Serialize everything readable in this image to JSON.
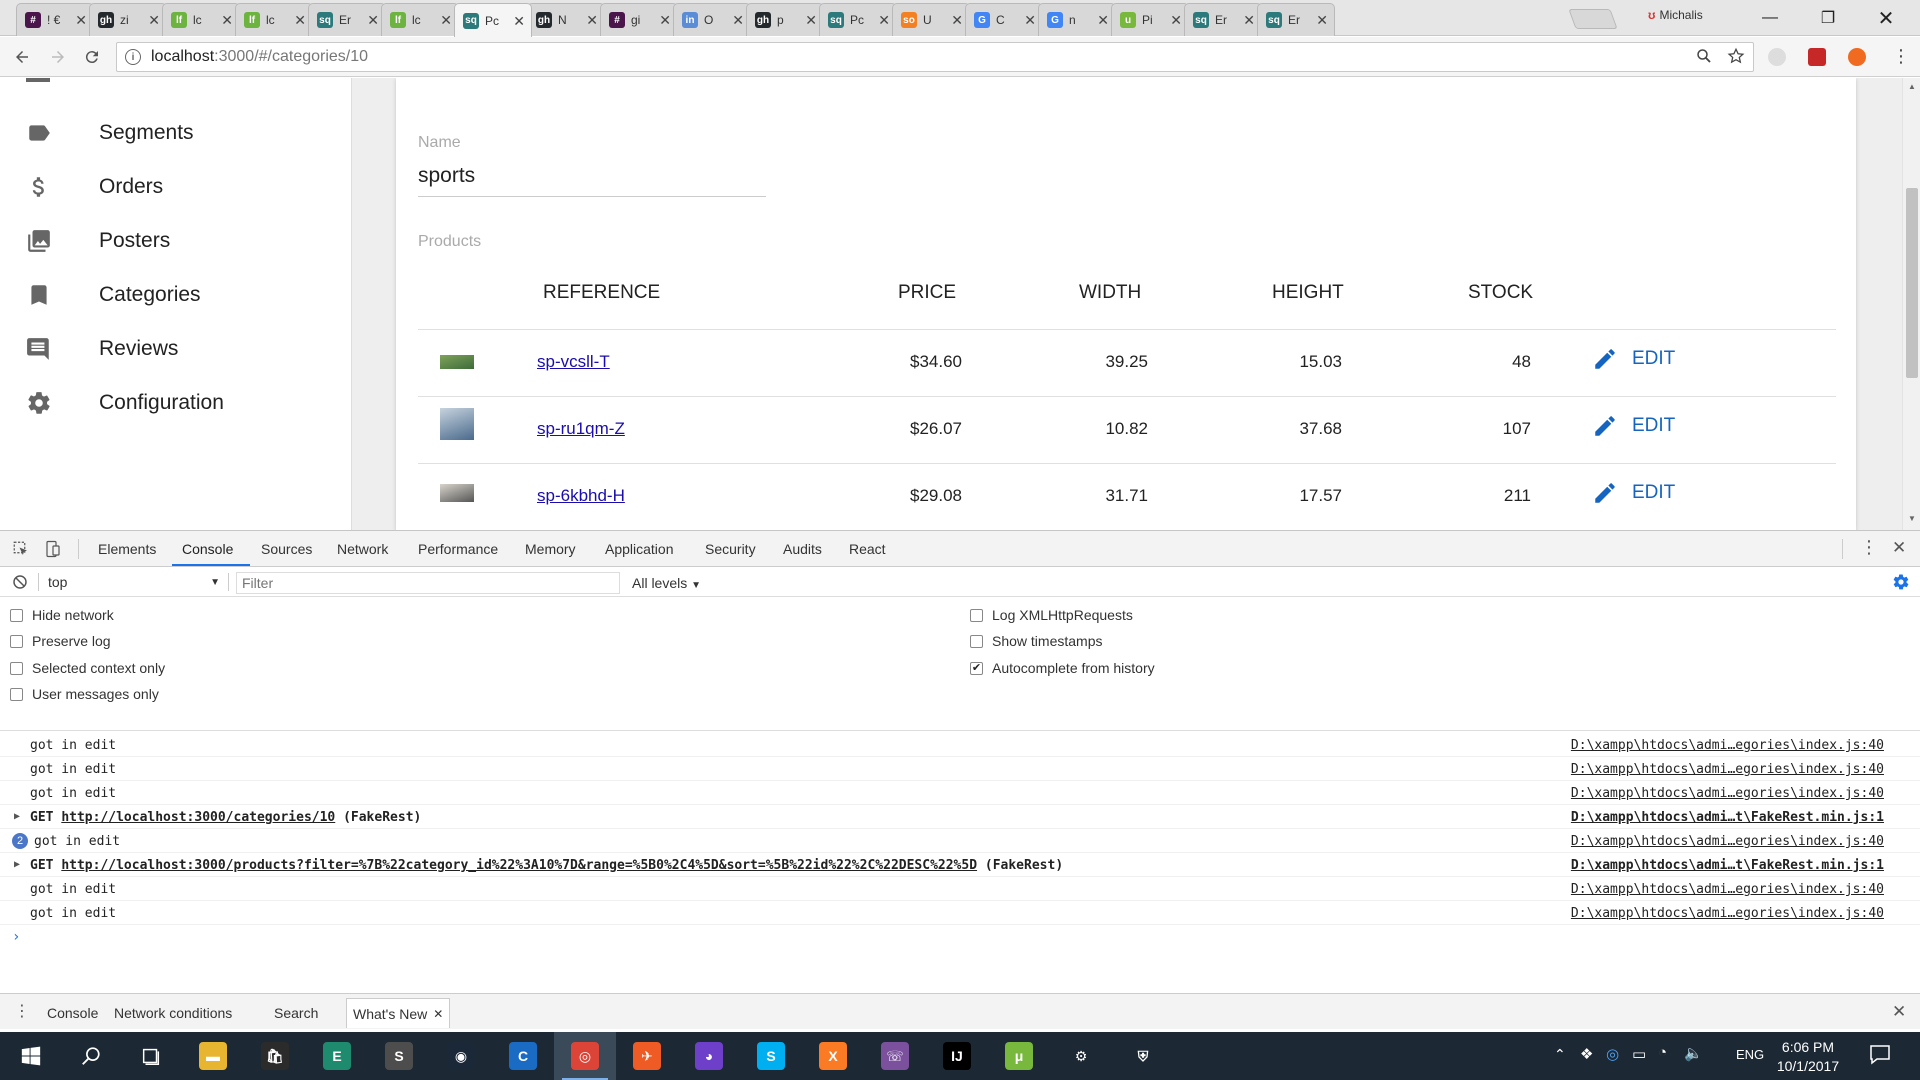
{
  "browser": {
    "tabs": [
      {
        "title": "! €",
        "color": "#4a154b",
        "glyph": "#"
      },
      {
        "title": "zi",
        "color": "#24292e",
        "glyph": "gh"
      },
      {
        "title": "lc",
        "color": "#6db33f",
        "glyph": "lf"
      },
      {
        "title": "lc",
        "color": "#6db33f",
        "glyph": "lf"
      },
      {
        "title": "Er",
        "color": "#2c7a7b",
        "glyph": "sq"
      },
      {
        "title": "lc",
        "color": "#6db33f",
        "glyph": "lf"
      },
      {
        "title": "Pc",
        "color": "#2c7a7b",
        "glyph": "sq"
      },
      {
        "title": "N",
        "color": "#24292e",
        "glyph": "gh"
      },
      {
        "title": "gi",
        "color": "#4a154b",
        "glyph": "#"
      },
      {
        "title": "O",
        "color": "#5b8cd6",
        "glyph": "in"
      },
      {
        "title": "p",
        "color": "#24292e",
        "glyph": "gh"
      },
      {
        "title": "Pc",
        "color": "#2c7a7b",
        "glyph": "sq"
      },
      {
        "title": "U",
        "color": "#f48024",
        "glyph": "so"
      },
      {
        "title": "C",
        "color": "#4285f4",
        "glyph": "G"
      },
      {
        "title": "n",
        "color": "#4285f4",
        "glyph": "G"
      },
      {
        "title": "Pi",
        "color": "#78b83c",
        "glyph": "u"
      },
      {
        "title": "Er",
        "color": "#2c7a7b",
        "glyph": "sq"
      },
      {
        "title": "Er",
        "color": "#2c7a7b",
        "glyph": "sq"
      }
    ],
    "active_tab_index": 6,
    "profile_name": "Michalis",
    "url_host": "localhost",
    "url_path": ":3000/#/categories/10"
  },
  "sidebar": {
    "items": [
      {
        "label": "Segments",
        "icon": "label-icon"
      },
      {
        "label": "Orders",
        "icon": "dollar-icon"
      },
      {
        "label": "Posters",
        "icon": "photo-library-icon"
      },
      {
        "label": "Categories",
        "icon": "bookmark-icon"
      },
      {
        "label": "Reviews",
        "icon": "comment-icon"
      },
      {
        "label": "Configuration",
        "icon": "gear-icon"
      }
    ]
  },
  "form": {
    "name_label": "Name",
    "name_value": "sports",
    "products_label": "Products",
    "columns": [
      "REFERENCE",
      "PRICE",
      "WIDTH",
      "HEIGHT",
      "STOCK"
    ],
    "edit_label": "EDIT",
    "rows": [
      {
        "reference": "sp-vcsll-T",
        "price": "$34.60",
        "width": "39.25",
        "height": "15.03",
        "stock": "48",
        "thumb_colors": [
          "#7fa35a",
          "#3d6b3a"
        ]
      },
      {
        "reference": "sp-ru1qm-Z",
        "price": "$26.07",
        "width": "10.82",
        "height": "37.68",
        "stock": "107",
        "thumb_colors": [
          "#c7d3de",
          "#4a6a8c"
        ]
      },
      {
        "reference": "sp-6kbhd-H",
        "price": "$29.08",
        "width": "31.71",
        "height": "17.57",
        "stock": "211",
        "thumb_colors": [
          "#d8d4cc",
          "#555"
        ]
      }
    ]
  },
  "devtools": {
    "tabs": [
      "Elements",
      "Console",
      "Sources",
      "Network",
      "Performance",
      "Memory",
      "Application",
      "Security",
      "Audits",
      "React"
    ],
    "active_tab": "Console",
    "context": "top",
    "filter_placeholder": "Filter",
    "levels_label": "All levels",
    "options_left": [
      {
        "label": "Hide network",
        "checked": false
      },
      {
        "label": "Preserve log",
        "checked": false
      },
      {
        "label": "Selected context only",
        "checked": false
      },
      {
        "label": "User messages only",
        "checked": false
      }
    ],
    "options_right": [
      {
        "label": "Log XMLHttpRequests",
        "checked": false
      },
      {
        "label": "Show timestamps",
        "checked": false
      },
      {
        "label": "Autocomplete from history",
        "checked": true
      }
    ],
    "logs": [
      {
        "type": "log",
        "text": "got in edit",
        "source": "D:\\xampp\\htdocs\\admi…egories\\index.js:40"
      },
      {
        "type": "log",
        "text": "got in edit",
        "source": "D:\\xampp\\htdocs\\admi…egories\\index.js:40"
      },
      {
        "type": "log",
        "text": "got in edit",
        "source": "D:\\xampp\\htdocs\\admi…egories\\index.js:40"
      },
      {
        "type": "xhr",
        "method": "GET",
        "url": "http://localhost:3000/categories/10",
        "suffix": "(FakeRest)",
        "source": "D:\\xampp\\htdocs\\admi…t\\FakeRest.min.js:1"
      },
      {
        "type": "log",
        "count": "2",
        "text": "got in edit",
        "source": "D:\\xampp\\htdocs\\admi…egories\\index.js:40"
      },
      {
        "type": "xhr",
        "method": "GET",
        "url": "http://localhost:3000/products?filter=%7B%22category_id%22%3A10%7D&range=%5B0%2C4%5D&sort=%5B%22id%22%2C%22DESC%22%5D",
        "suffix": "(FakeRest)",
        "source": "D:\\xampp\\htdocs\\admi…t\\FakeRest.min.js:1"
      },
      {
        "type": "log",
        "text": "got in edit",
        "source": "D:\\xampp\\htdocs\\admi…egories\\index.js:40"
      },
      {
        "type": "log",
        "text": "got in edit",
        "source": "D:\\xampp\\htdocs\\admi…egories\\index.js:40"
      }
    ],
    "drawer_tabs": [
      "Console",
      "Network conditions",
      "Search"
    ],
    "drawer_active": "What's New"
  },
  "taskbar": {
    "apps": [
      {
        "name": "file-explorer-icon",
        "color": "#e8b530",
        "glyph": "▬"
      },
      {
        "name": "store-icon",
        "color": "#2b2b2b",
        "glyph": "🛍"
      },
      {
        "name": "editor-icon",
        "color": "#1e8a6e",
        "glyph": "E"
      },
      {
        "name": "sublime-icon",
        "color": "#4d4d4d",
        "glyph": "S"
      },
      {
        "name": "steam-icon",
        "color": "#1b2838",
        "glyph": "◉"
      },
      {
        "name": "ccleaner-icon",
        "color": "#1a6bc4",
        "glyph": "C"
      },
      {
        "name": "chrome-icon",
        "color": "#db4437",
        "glyph": "◎"
      },
      {
        "name": "postman-icon",
        "color": "#ef5b25",
        "glyph": "✈"
      },
      {
        "name": "github-desktop-icon",
        "color": "#6e40c9",
        "glyph": "◕"
      },
      {
        "name": "skype-icon",
        "color": "#00aff0",
        "glyph": "S"
      },
      {
        "name": "xampp-icon",
        "color": "#fb7a24",
        "glyph": "X"
      },
      {
        "name": "viber-icon",
        "color": "#7b519d",
        "glyph": "☏"
      },
      {
        "name": "intellij-icon",
        "color": "#000000",
        "glyph": "IJ"
      },
      {
        "name": "utorrent-icon",
        "color": "#78b83c",
        "glyph": "μ"
      },
      {
        "name": "settings-icon",
        "color": "#1c2833",
        "glyph": "⚙"
      },
      {
        "name": "defender-icon",
        "color": "#1c2833",
        "glyph": "⛨"
      }
    ],
    "active_app_index": 6,
    "language": "ENG",
    "time": "6:06 PM",
    "date": "10/1/2017"
  }
}
